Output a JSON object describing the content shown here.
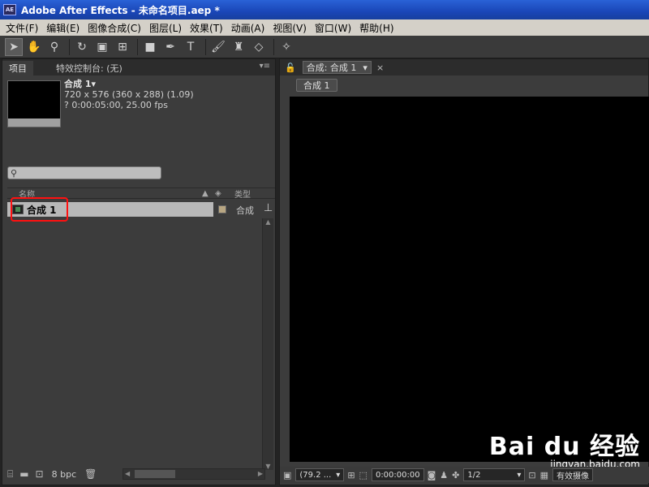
{
  "window": {
    "title": "Adobe After Effects - 未命名项目.aep *",
    "logo": "AE"
  },
  "menu": [
    "文件(F)",
    "编辑(E)",
    "图像合成(C)",
    "图层(L)",
    "效果(T)",
    "动画(A)",
    "视图(V)",
    "窗口(W)",
    "帮助(H)"
  ],
  "project_panel": {
    "tab_project": "项目",
    "tab_effects": "特效控制台: (无)",
    "comp_name": "合成 1▾",
    "comp_size": "720 x 576  (360 x 288) (1.09)",
    "comp_duration": "? 0:00:05:00, 25.00 fps",
    "col_name": "名称",
    "col_type": "类型",
    "item_name": "合成 1",
    "item_type": "合成",
    "bpc": "8 bpc"
  },
  "comp_panel": {
    "tab_label": "合成: 合成 1",
    "comp_button": "合成 1",
    "zoom": "(79.2 ...",
    "timecode": "0:00:00:00",
    "resolution": "1/2",
    "camera": "有效摄像"
  },
  "watermark": {
    "logo": "Bai du 经验",
    "url": "jingyan.baidu.com"
  },
  "icons": [
    "select-icon",
    "hand-icon",
    "zoom-icon",
    "rotate-icon",
    "camera-orbit-icon",
    "pan-behind-icon",
    "rect-mask-icon",
    "pen-icon",
    "text-icon",
    "brush-icon",
    "clone-icon",
    "eraser-icon",
    "puppet-icon"
  ]
}
